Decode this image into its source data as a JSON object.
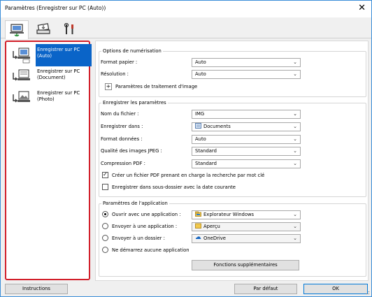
{
  "window": {
    "title": "Paramètres (Enregistrer sur PC (Auto))",
    "close_glyph": "✕"
  },
  "tabs": [
    {
      "icon": "scan-to-pc-icon"
    },
    {
      "icon": "scanner-icon"
    },
    {
      "icon": "tools-icon"
    }
  ],
  "sidebar": {
    "items": [
      {
        "label_line1": "Enregistrer sur PC",
        "label_line2": "(Auto)"
      },
      {
        "label_line1": "Enregistrer sur PC",
        "label_line2": "(Document)"
      },
      {
        "label_line1": "Enregistrer sur PC",
        "label_line2": "(Photo)"
      }
    ]
  },
  "scan_options": {
    "legend": "Options de numérisation",
    "paper_size": {
      "label": "Format papier :",
      "value": "Auto"
    },
    "resolution": {
      "label": "Résolution :",
      "value": "Auto"
    },
    "image_processing_label": "Paramètres de traitement d'image",
    "plus_glyph": "+"
  },
  "save_settings": {
    "legend": "Enregistrer les paramètres",
    "file_name": {
      "label": "Nom du fichier :",
      "value": "IMG"
    },
    "save_in": {
      "label": "Enregistrer dans :",
      "value": "Documents"
    },
    "data_format": {
      "label": "Format données :",
      "value": "Auto"
    },
    "jpeg_quality": {
      "label": "Qualité des images JPEG :",
      "value": "Standard"
    },
    "pdf_compression": {
      "label": "Compression PDF :",
      "value": "Standard"
    },
    "searchable_pdf": {
      "label": "Créer un fichier PDF prenant en charge la recherche par mot clé",
      "checked": true
    },
    "date_subfolder": {
      "label": "Enregistrer dans sous-dossier avec la date courante",
      "checked": false
    }
  },
  "app_settings": {
    "legend": "Paramètres de l'application",
    "open_with": {
      "label": "Ouvrir avec une application :",
      "value": "Explorateur Windows",
      "selected": true
    },
    "send_to_app": {
      "label": "Envoyer à une application :",
      "value": "Aperçu",
      "selected": false
    },
    "send_to_folder": {
      "label": "Envoyer à un dossier :",
      "value": "OneDrive",
      "selected": false
    },
    "no_app": {
      "label": "Ne démarrez aucune application",
      "selected": false
    },
    "more_functions_label": "Fonctions supplémentaires"
  },
  "footer": {
    "instructions_label": "Instructions",
    "default_label": "Par défaut",
    "ok_label": "OK"
  },
  "colors": {
    "selection": "#0a64c8",
    "highlight_border": "#d21f2a",
    "window_border": "#3b8ed8"
  },
  "chevron_glyph": "⌄"
}
